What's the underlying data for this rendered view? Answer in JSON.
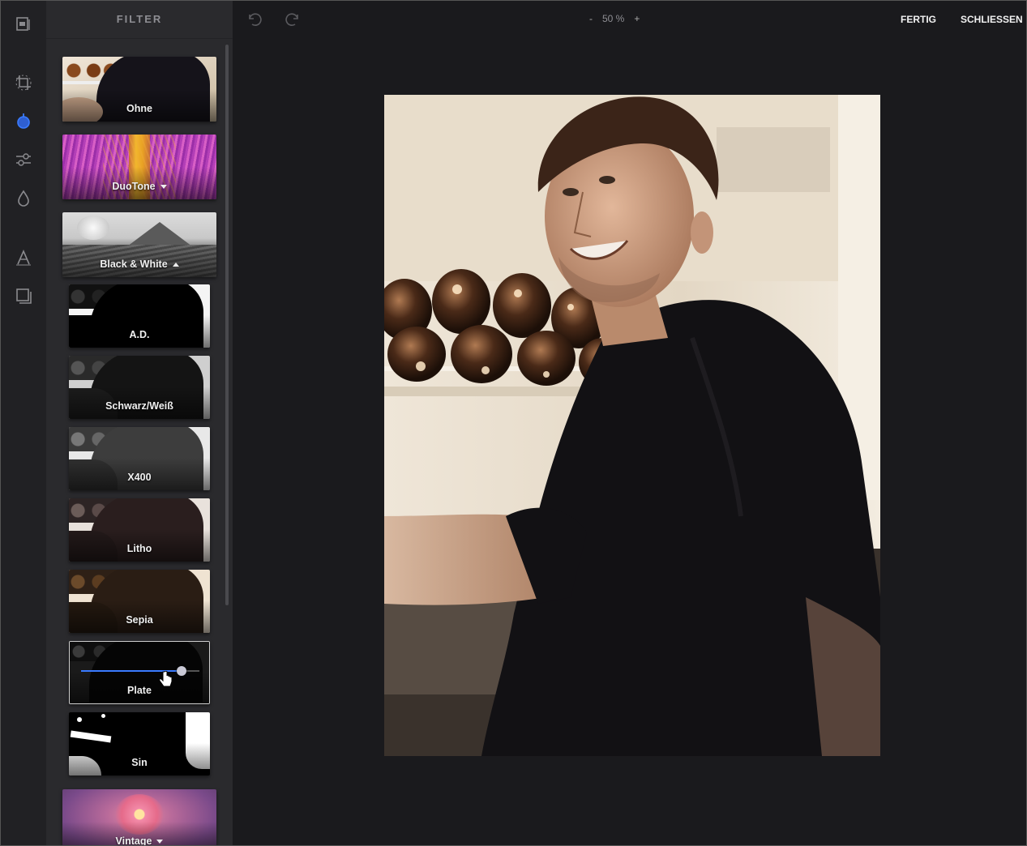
{
  "panel": {
    "title": "FILTER"
  },
  "rail": {
    "tools": [
      {
        "name": "library-icon"
      },
      {
        "name": "crop-icon"
      },
      {
        "name": "filter-icon",
        "active": true
      },
      {
        "name": "adjust-icon"
      },
      {
        "name": "focus-drop-icon"
      },
      {
        "name": "text-icon"
      },
      {
        "name": "frame-icon"
      }
    ]
  },
  "filters": {
    "ohne": "Ohne",
    "duotone": "DuoTone",
    "bw": "Black & White",
    "ad": "A.D.",
    "schwarzweiss": "Schwarz/Weiß",
    "x400": "X400",
    "litho": "Litho",
    "sepia": "Sepia",
    "plate": "Plate",
    "sin": "Sin",
    "vintage": "Vintage"
  },
  "plate_intensity": 0.85,
  "toolbar": {
    "zoom_minus": "-",
    "zoom_value": "50 %",
    "zoom_plus": "+",
    "done_label": "FERTIG",
    "close_label": "SCHLIESSEN"
  },
  "colors": {
    "accent": "#3a7bff",
    "panel_bg": "#2a2a2d",
    "canvas_bg": "#1a1a1d"
  }
}
